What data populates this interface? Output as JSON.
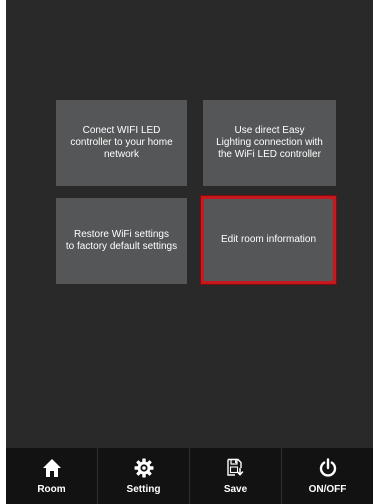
{
  "tiles": [
    {
      "label": "Conect WIFI LED\ncontroller to your home\nnetwork",
      "selected": false
    },
    {
      "label": "Use direct Easy\nLighting connection with\nthe WiFi LED controller",
      "selected": false
    },
    {
      "label": "Restore WiFi settings\nto factory default settings",
      "selected": false
    },
    {
      "label": "Edit room information",
      "selected": true
    }
  ],
  "nav": [
    {
      "label": "Room",
      "icon": "home-icon"
    },
    {
      "label": "Setting",
      "icon": "gear-icon"
    },
    {
      "label": "Save",
      "icon": "save-icon"
    },
    {
      "label": "ON/OFF",
      "icon": "power-icon"
    }
  ],
  "colors": {
    "background": "#29292a",
    "tile": "#555657",
    "selected_border": "#c8181d",
    "bottom_bar": "#121212",
    "text": "#ffffff"
  }
}
